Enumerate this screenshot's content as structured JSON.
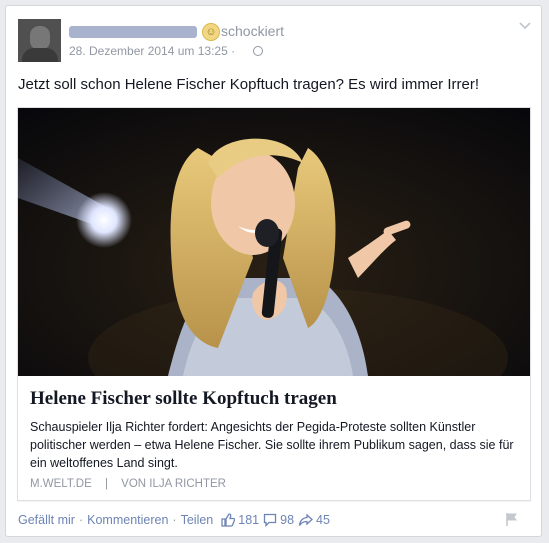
{
  "post": {
    "feeling_icon": "smiley-icon",
    "feeling": "schockiert",
    "date": "28. Dezember 2014 um 13:25",
    "meta_separator": "·",
    "status_text": "Jetzt soll schon Helene Fischer Kopftuch tragen? Es wird immer Irrer!"
  },
  "link": {
    "title": "Helene Fischer sollte Kopftuch tragen",
    "description": "Schauspieler Ilja Richter fordert: Angesichts der Pegida-Proteste sollten Künstler politischer werden – etwa Helene Fischer. Sie sollte ihrem Publikum sagen, dass sie für ein weltoffenes Land singt.",
    "domain": "M.WELT.DE",
    "separator": "|",
    "author": "VON ILJA RICHTER"
  },
  "actions": {
    "like": "Gefällt mir",
    "comment": "Kommentieren",
    "share": "Teilen",
    "dot": "·",
    "like_count": "181",
    "comment_count": "98",
    "share_count": "45"
  },
  "colors": {
    "link_blue": "#6d84b4",
    "meta_gray": "#9197a3"
  }
}
